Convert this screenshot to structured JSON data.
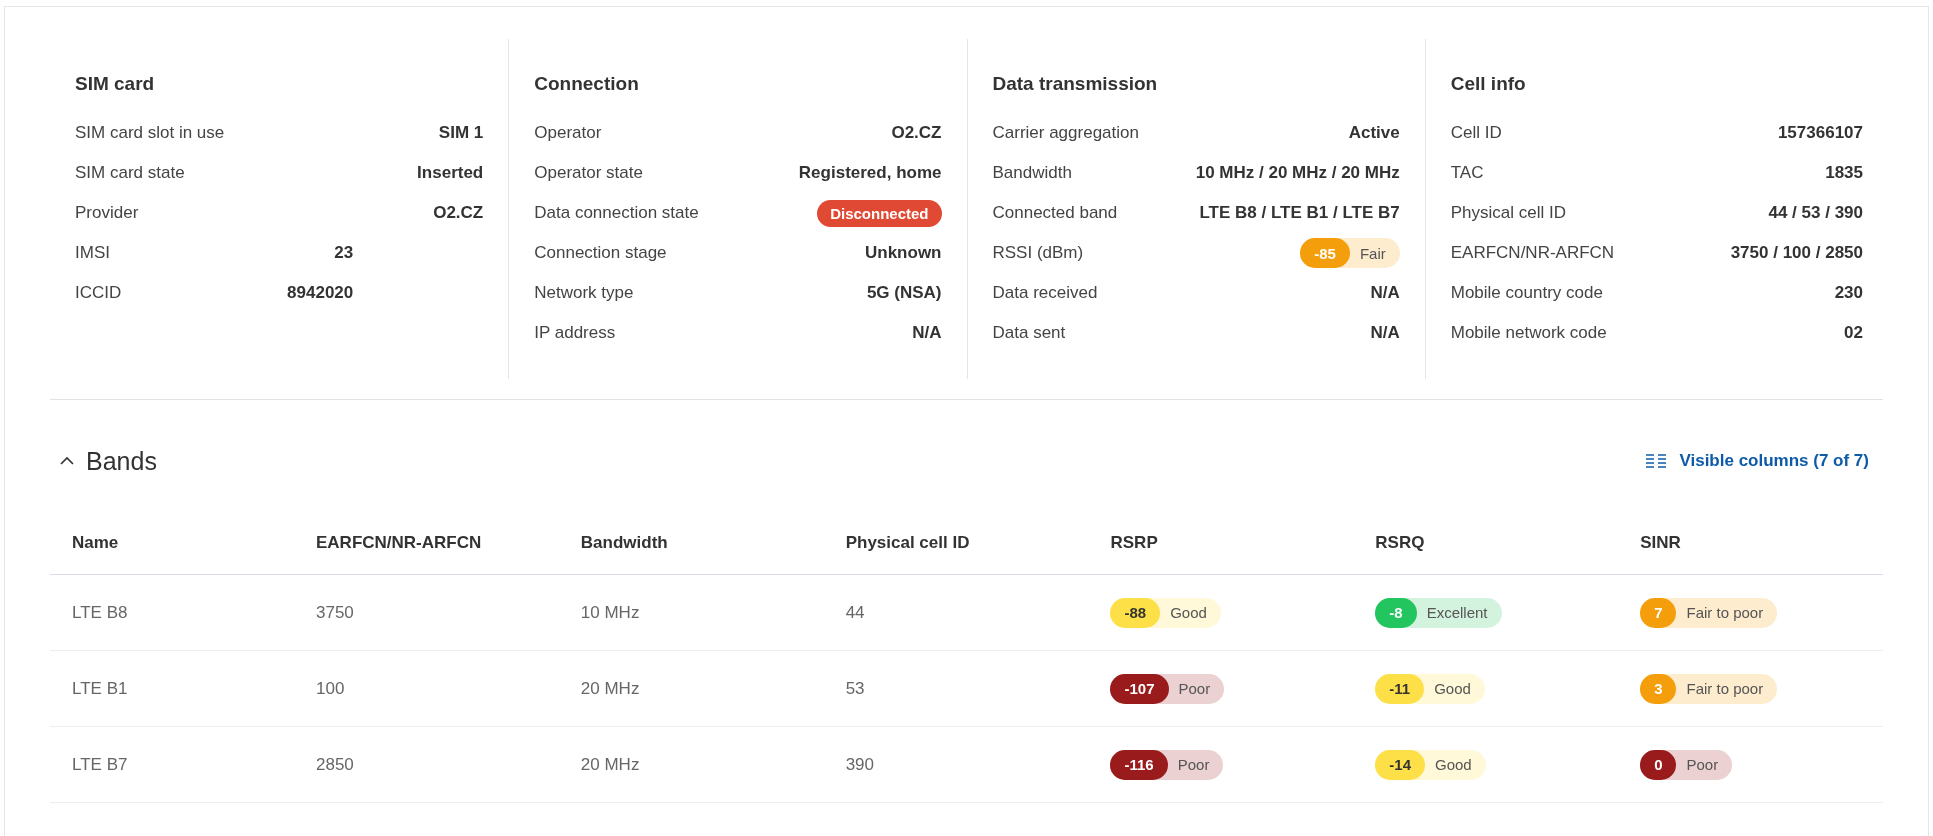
{
  "sections": [
    {
      "title": "SIM card",
      "rows": [
        {
          "label": "SIM card slot in use",
          "value": "SIM 1",
          "kind": "text"
        },
        {
          "label": "SIM card state",
          "value": "Inserted",
          "kind": "text"
        },
        {
          "label": "Provider",
          "value": "O2.CZ",
          "kind": "text"
        },
        {
          "label": "IMSI",
          "value": "23",
          "kind": "clipped"
        },
        {
          "label": "ICCID",
          "value": "8942020",
          "kind": "clipped"
        }
      ]
    },
    {
      "title": "Connection",
      "rows": [
        {
          "label": "Operator",
          "value": "O2.CZ",
          "kind": "text"
        },
        {
          "label": "Operator state",
          "value": "Registered, home",
          "kind": "text"
        },
        {
          "label": "Data connection state",
          "value": "Disconnected",
          "kind": "status"
        },
        {
          "label": "Connection stage",
          "value": "Unknown",
          "kind": "text"
        },
        {
          "label": "Network type",
          "value": "5G (NSA)",
          "kind": "text"
        },
        {
          "label": "IP address",
          "value": "N/A",
          "kind": "text"
        }
      ]
    },
    {
      "title": "Data transmission",
      "rows": [
        {
          "label": "Carrier aggregation",
          "value": "Active",
          "kind": "text"
        },
        {
          "label": "Bandwidth",
          "value": "10 MHz / 20 MHz / 20 MHz",
          "kind": "text"
        },
        {
          "label": "Connected band",
          "value": "LTE B8 / LTE B1 / LTE B7",
          "kind": "text"
        },
        {
          "label": "RSSI (dBm)",
          "value": "-85",
          "rating": "Fair",
          "color": "#f59e0b",
          "kind": "signal"
        },
        {
          "label": "Data received",
          "value": "N/A",
          "kind": "text"
        },
        {
          "label": "Data sent",
          "value": "N/A",
          "kind": "text"
        }
      ]
    },
    {
      "title": "Cell info",
      "rows": [
        {
          "label": "Cell ID",
          "value": "157366107",
          "kind": "text"
        },
        {
          "label": "TAC",
          "value": "1835",
          "kind": "text"
        },
        {
          "label": "Physical cell ID",
          "value": "44 / 53 / 390",
          "kind": "text"
        },
        {
          "label": "EARFCN/NR-ARFCN",
          "value": "3750 / 100 / 2850",
          "kind": "text"
        },
        {
          "label": "Mobile country code",
          "value": "230",
          "kind": "text"
        },
        {
          "label": "Mobile network code",
          "value": "02",
          "kind": "text"
        }
      ]
    }
  ],
  "bands": {
    "title": "Bands",
    "expanded": true,
    "visible_columns": "Visible columns (7 of 7)",
    "columns": [
      "Name",
      "EARFCN/NR-ARFCN",
      "Bandwidth",
      "Physical cell ID",
      "RSRP",
      "RSRQ",
      "SINR"
    ],
    "rows": [
      {
        "cells": [
          "LTE B8",
          "3750",
          "10 MHz",
          "44"
        ],
        "signals": [
          {
            "value": "-88",
            "rating": "Good",
            "color": "#fde047"
          },
          {
            "value": "-8",
            "rating": "Excellent",
            "color": "#22c55e"
          },
          {
            "value": "7",
            "rating": "Fair to poor",
            "color": "#f59e0b"
          }
        ]
      },
      {
        "cells": [
          "LTE B1",
          "100",
          "20 MHz",
          "53"
        ],
        "signals": [
          {
            "value": "-107",
            "rating": "Poor",
            "color": "#991b1b"
          },
          {
            "value": "-11",
            "rating": "Good",
            "color": "#fde047"
          },
          {
            "value": "3",
            "rating": "Fair to poor",
            "color": "#f59e0b"
          }
        ]
      },
      {
        "cells": [
          "LTE B7",
          "2850",
          "20 MHz",
          "390"
        ],
        "signals": [
          {
            "value": "-116",
            "rating": "Poor",
            "color": "#991b1b"
          },
          {
            "value": "-14",
            "rating": "Good",
            "color": "#fde047"
          },
          {
            "value": "0",
            "rating": "Poor",
            "color": "#991b1b"
          }
        ]
      }
    ]
  }
}
